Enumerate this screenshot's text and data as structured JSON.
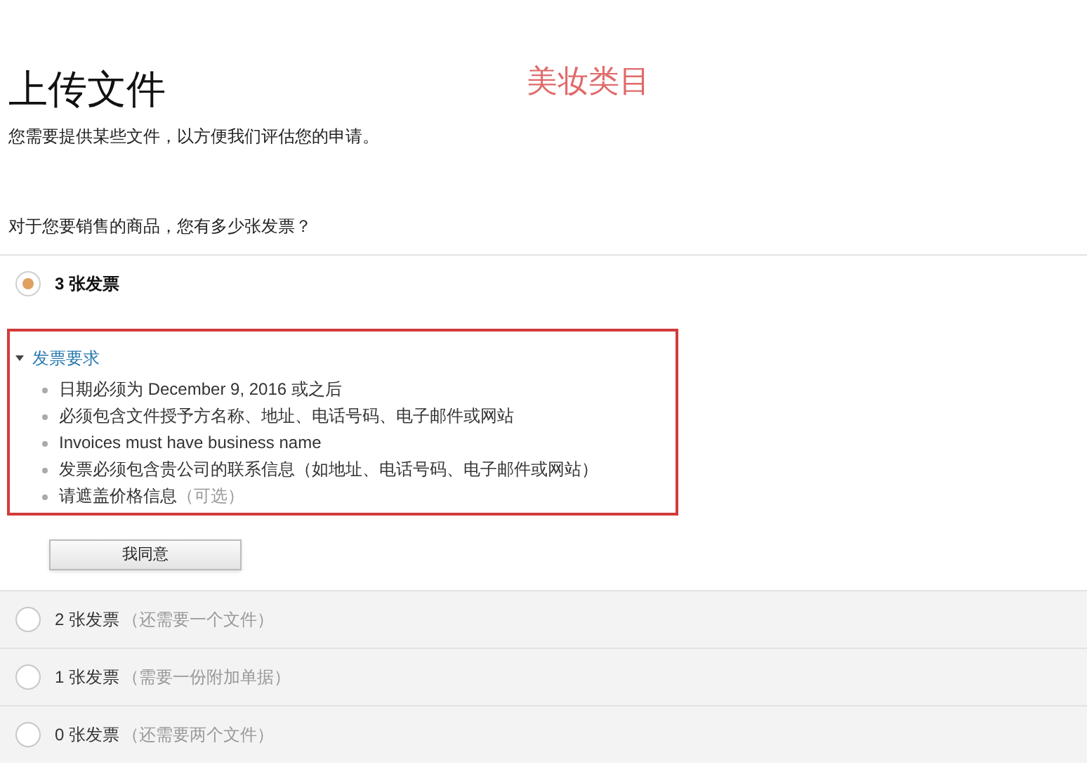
{
  "annotation": "美妆类目",
  "title": "上传文件",
  "description": "您需要提供某些文件，以方便我们评估您的申请。",
  "question": "对于您要销售的商品，您有多少张发票？",
  "options": [
    {
      "label": "3 张发票",
      "selected": true,
      "requirements": {
        "title": "发票要求",
        "expanded": true,
        "highlighted": true,
        "items": [
          {
            "text": "日期必须为 December 9, 2016 或之后"
          },
          {
            "text": "必须包含文件授予方名称、地址、电话号码、电子邮件或网站"
          },
          {
            "text": "Invoices must have business name"
          },
          {
            "text": "发票必须包含贵公司的联系信息（如地址、电话号码、电子邮件或网站）"
          },
          {
            "text": "请遮盖价格信息",
            "note": "（可选）"
          }
        ]
      },
      "button": "我同意"
    },
    {
      "label": "2 张发票",
      "note": "（还需要一个文件）",
      "selected": false
    },
    {
      "label": "1 张发票",
      "note": "（需要一份附加单据）",
      "selected": false
    },
    {
      "label": "0 张发票",
      "note": "（还需要两个文件）",
      "selected": false
    }
  ]
}
